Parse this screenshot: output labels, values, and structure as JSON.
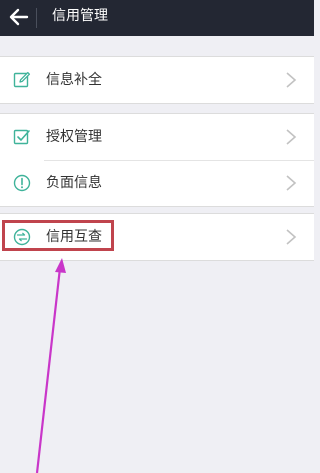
{
  "header": {
    "back_icon": "back-arrow-icon",
    "title": "信用管理"
  },
  "groups": [
    {
      "items": [
        {
          "label": "信息补全",
          "icon": "edit-icon"
        }
      ]
    },
    {
      "items": [
        {
          "label": "授权管理",
          "icon": "checkbox-icon"
        },
        {
          "label": "负面信息",
          "icon": "warning-icon"
        }
      ]
    },
    {
      "items": [
        {
          "label": "信用互查",
          "icon": "credit-exchange-icon"
        }
      ]
    }
  ],
  "colors": {
    "header_bg": "#232733",
    "icon_accent": "#3fb39a",
    "highlight_box": "#c0444d",
    "annotation_arrow": "#c936c9",
    "page_bg": "#efeff4"
  }
}
